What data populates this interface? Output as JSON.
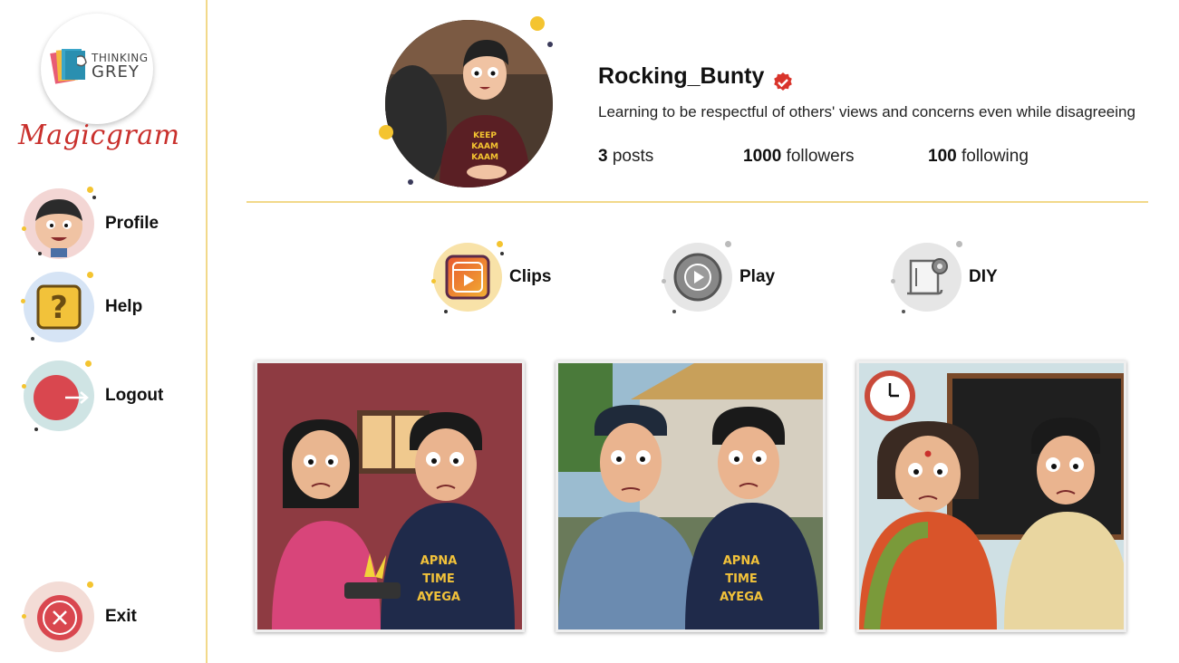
{
  "app": {
    "logo_line1": "THINKING",
    "logo_line2": "GREY",
    "brand_name": "Magicgram"
  },
  "sidebar": {
    "items": [
      {
        "label": "Profile",
        "icon": "avatar-icon"
      },
      {
        "label": "Help",
        "icon": "question-icon"
      },
      {
        "label": "Logout",
        "icon": "logout-icon"
      }
    ],
    "exit_label": "Exit"
  },
  "profile": {
    "username": "Rocking_Bunty",
    "verified": true,
    "bio": "Learning to be respectful of others' views and concerns even while disagreeing",
    "posts_count": "3",
    "posts_label": "posts",
    "followers_count": "1000",
    "followers_label": "followers",
    "following_count": "100",
    "following_label": "following",
    "shirt_text": [
      "KEEP",
      "KAAM",
      "KAAM"
    ]
  },
  "tabs": [
    {
      "label": "Clips",
      "icon": "clips-icon"
    },
    {
      "label": "Play",
      "icon": "play-icon"
    },
    {
      "label": "DIY",
      "icon": "scroll-gear-icon"
    }
  ],
  "posts": [
    {
      "shirt_text": [
        "APNA",
        "TIME",
        "AYEGA"
      ]
    },
    {
      "shirt_text": [
        "APNA",
        "TIME",
        "AYEGA"
      ]
    }
  ],
  "colors": {
    "accent_line": "#f2d98a",
    "brand_red": "#c9302c",
    "verified_red": "#d9342b"
  }
}
